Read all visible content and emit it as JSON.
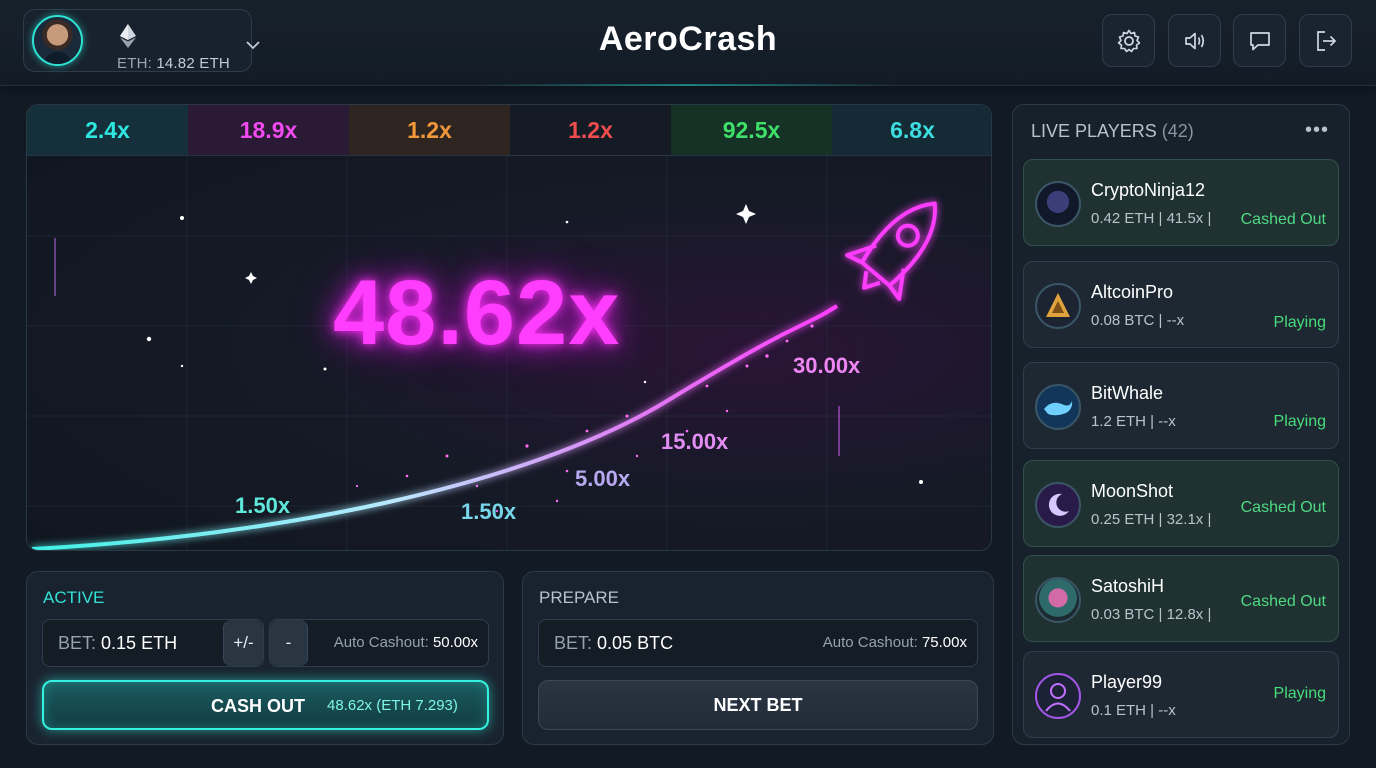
{
  "header": {
    "title": "AeroCrash",
    "balance_label": "ETH:",
    "balance_value": "14.82 ETH"
  },
  "history": [
    {
      "value": "2.4x",
      "color": "#2ee6e0",
      "bg": "#15303a"
    },
    {
      "value": "18.9x",
      "color": "#f04af0",
      "bg": "#2a1a36"
    },
    {
      "value": "1.2x",
      "color": "#f3983a",
      "bg": "#2e2420"
    },
    {
      "value": "1.2x",
      "color": "#ef4d4d",
      "bg": "#141b24"
    },
    {
      "value": "92.5x",
      "color": "#3fe06a",
      "bg": "#163226"
    },
    {
      "value": "6.8x",
      "color": "#3ddde0",
      "bg": "#142a35"
    }
  ],
  "game": {
    "current_multiplier": "48.62x",
    "curve_labels": [
      "1.50x",
      "1.50x",
      "5.00x",
      "15.00x",
      "30.00x"
    ]
  },
  "active_bet": {
    "title": "ACTIVE",
    "bet_label": "BET:",
    "bet_value": "0.15 ETH",
    "plus_minus": "+/-",
    "minus": "-",
    "auto_label": "Auto Cashout:",
    "auto_value": "50.00x",
    "cashout_label": "CASH OUT",
    "cashout_value": "48.62x (ETH 7.293)"
  },
  "prepare_bet": {
    "title": "PREPARE",
    "bet_label": "BET:",
    "bet_value": "0.05 BTC",
    "auto_label": "Auto Cashout:",
    "auto_value": "75.00x",
    "next_label": "NEXT BET"
  },
  "players": {
    "title": "LIVE PLAYERS",
    "count": "(42)",
    "menu": "•••",
    "list": [
      {
        "name": "CryptoNinja12",
        "info": "0.42 ETH  |  41.5x  |",
        "status": "Cashed Out",
        "cashed": true
      },
      {
        "name": "AltcoinPro",
        "info": "0.08 BTC  |  --x",
        "status": "Playing",
        "cashed": false
      },
      {
        "name": "BitWhale",
        "info": "1.2 ETH  |  --x",
        "status": "Playing",
        "cashed": false
      },
      {
        "name": "MoonShot",
        "info": "0.25 ETH  |  32.1x  |",
        "status": "Cashed Out",
        "cashed": true
      },
      {
        "name": "SatoshiH",
        "info": "0.03 BTC  |  12.8x  |",
        "status": "Cashed Out",
        "cashed": true
      },
      {
        "name": "Player99",
        "info": "0.1 ETH  |  --x",
        "status": "Playing",
        "cashed": false
      }
    ]
  },
  "colors": {
    "accent": "#35f2e0",
    "rocket": "#ff3dff",
    "status_green": "#49dc7a"
  }
}
